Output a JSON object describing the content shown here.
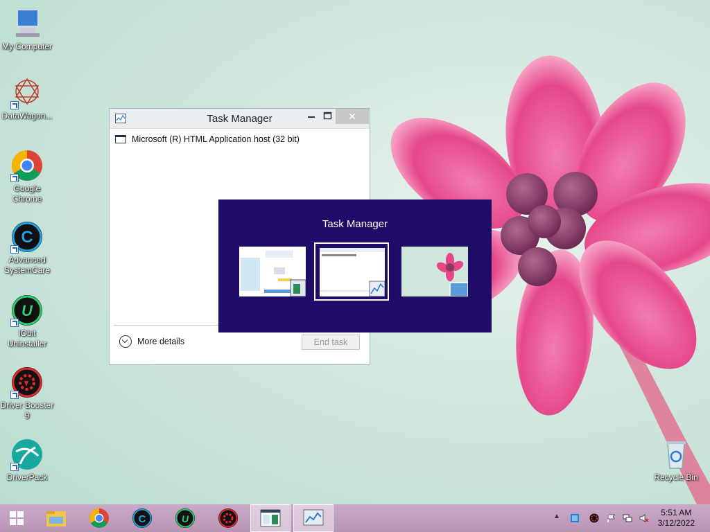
{
  "desktop": {
    "icons": [
      {
        "label": "My Computer",
        "icon": "computer-icon"
      },
      {
        "label": "DataWagon...",
        "icon": "datawagon-icon"
      },
      {
        "label": "Google Chrome",
        "icon": "chrome-icon"
      },
      {
        "label": "Advanced SystemCare",
        "icon": "advanced-systemcare-icon"
      },
      {
        "label": "IObit Uninstaller",
        "icon": "iobit-uninstaller-icon"
      },
      {
        "label": "Driver Booster 9",
        "icon": "driver-booster-icon"
      },
      {
        "label": "DriverPack",
        "icon": "driverpack-icon"
      },
      {
        "label": "Recycle Bin",
        "icon": "recycle-bin-icon"
      }
    ]
  },
  "task_manager": {
    "title": "Task Manager",
    "close_glyph": "✕",
    "processes": [
      {
        "name": "Microsoft (R) HTML Application host (32 bit)"
      }
    ],
    "more_details_label": "More details",
    "end_task_label": "End task"
  },
  "switcher": {
    "title": "Task Manager",
    "thumbnails": [
      {
        "name": "hta-window-thumbnail"
      },
      {
        "name": "task-manager-thumbnail"
      },
      {
        "name": "desktop-thumbnail"
      }
    ]
  },
  "taskbar": {
    "items": [
      {
        "icon": "start-icon"
      },
      {
        "icon": "file-explorer-icon"
      },
      {
        "icon": "chrome-icon"
      },
      {
        "icon": "advanced-systemcare-icon"
      },
      {
        "icon": "iobit-uninstaller-icon"
      },
      {
        "icon": "driver-booster-icon"
      },
      {
        "icon": "hta-app-icon"
      },
      {
        "icon": "task-manager-icon"
      }
    ],
    "tray_up_glyph": "▲",
    "clock_time": "5:51 AM",
    "clock_date": "3/12/2022"
  },
  "colors": {
    "switcher_bg": "#1f0b68",
    "flower_pink": "#e5478a",
    "taskbar": "#c1a0be"
  }
}
